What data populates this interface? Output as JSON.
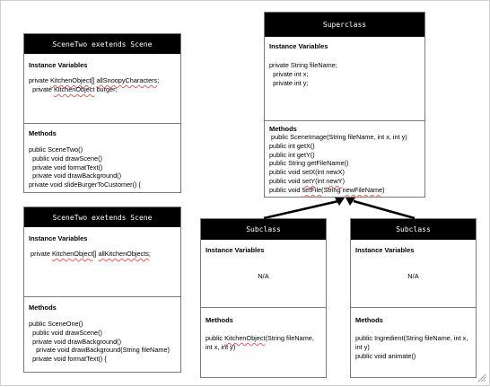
{
  "boxes": {
    "scene_two": {
      "header": "SceneTwo exetends Scene",
      "vars_title": "Instance Variables",
      "vars": [
        "private KitchenObject[] allSnoopyCharacters;",
        "  private KitchenObject burger;"
      ],
      "methods_title": "Methods",
      "methods": [
        "public SceneTwo()",
        "  public void drawScene()",
        "  private void formatText()",
        "  private void drawBackground()",
        "private void slideBurgerToCustomer() {"
      ]
    },
    "scene_one": {
      "header": "SceneTwo exetends Scene",
      "vars_title": "Instance Variables",
      "vars": [
        " private KitchenObject[] allKitchenObjects;"
      ],
      "methods_title": "Methods",
      "methods": [
        "public SceneOne()",
        "  public void drawScene()",
        "  private void drawBackground()",
        "    private void drawBackground(String fileName)",
        "  private void formatText() {"
      ]
    },
    "superclass": {
      "header": "Superclass",
      "vars_title": "Instance Variables",
      "vars": [
        "private String fileName;",
        "  private int x;",
        "  private int y;"
      ],
      "methods_title": "Methods",
      "methods": [
        " public SceneImage(String fileName, int x, int y)",
        "public int getX()",
        "public int getY()",
        "public String getFileName()",
        "public void setX(int newX)",
        "public void setY(int newY)",
        "public void setFile(String newFileName)"
      ]
    },
    "subclass_left": {
      "header": "Subclass",
      "vars_title": "Instance Variables",
      "na": "N/A",
      "methods_title": "Methods",
      "methods": [
        "public KitchenObject(String fileName, int x, int y)"
      ]
    },
    "subclass_right": {
      "header": "Subclass",
      "vars_title": "Instance Variables",
      "na": "N/A",
      "methods_title": "Methods",
      "methods": [
        "public Ingredient(String fileName, int x, int y)",
        "public void animate()"
      ]
    }
  },
  "colors": {
    "header_bg": "#000000",
    "header_text": "#ffffff",
    "border": "#7a7a7a",
    "spellcheck": "#e06060"
  }
}
